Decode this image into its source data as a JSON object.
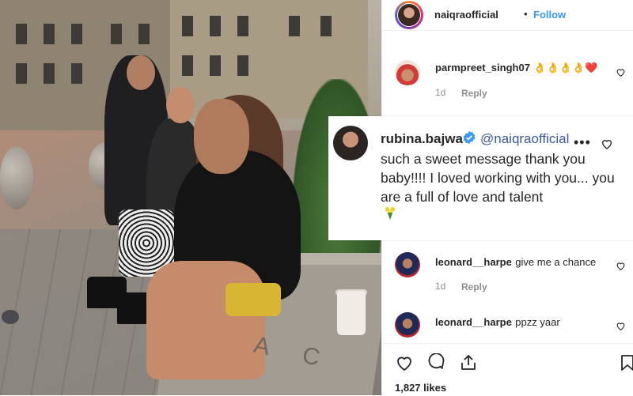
{
  "post": {
    "username": "naiqraofficial",
    "separator": "•",
    "follow_label": "Follow",
    "likes": "1,827 likes"
  },
  "comments": [
    {
      "username": "parmpreet_singh07",
      "text": "👌👌👌👌❤️",
      "age": "1d",
      "reply_label": "Reply"
    },
    {
      "username": "leonard__harpe",
      "text": "give me a chance",
      "age": "1d",
      "reply_label": "Reply"
    },
    {
      "username": "leonard__harpe",
      "text": "ppzz yaar"
    }
  ],
  "featured_comment": {
    "username": "rubina.bajwa",
    "mention": "@naiqraofficial",
    "text": "such a sweet message thank you baby!!!! I loved working with you... you are a full of love and talent",
    "more": "•••"
  },
  "photo_text": "A C",
  "colors": {
    "link": "#3897f0",
    "muted": "#8e8e8e",
    "heart": "#ed4956",
    "verified": "#3897f0"
  },
  "icons": [
    "heart-icon",
    "comment-icon",
    "share-icon",
    "bookmark-icon",
    "verified-icon",
    "more-icon"
  ]
}
